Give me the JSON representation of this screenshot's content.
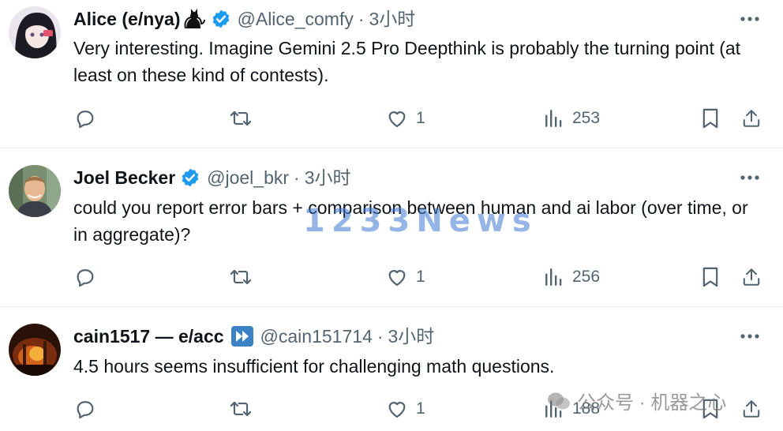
{
  "tweets": [
    {
      "name": "Alice (e/nya)",
      "handle": "@Alice_comfy",
      "time": "3小时",
      "text": "Very interesting. Imagine Gemini 2.5 Pro Deepthink is probably the turning point (at least on these kind of contests).",
      "likes": "1",
      "views": "253",
      "verified": true,
      "emoji_icon": "black-cat-icon"
    },
    {
      "name": "Joel Becker",
      "handle": "@joel_bkr",
      "time": "3小时",
      "text": "could you report error bars + comparison between human and ai labor (over time, or in aggregate)?",
      "likes": "1",
      "views": "256",
      "verified": true
    },
    {
      "name": "cain1517 — e/acc",
      "handle": "@cain151714",
      "time": "3小时",
      "text": "4.5 hours seems insufficient for challenging math questions.",
      "likes": "1",
      "views": "188",
      "verified": false,
      "emoji_icon": "fast-forward-icon"
    }
  ],
  "separator": "·",
  "watermark_text": "1233News",
  "footer_watermark": "公众号 · 机器之心",
  "colors": {
    "text": "#0f1419",
    "secondary": "#536471",
    "verified": "#1d9bf0",
    "divider": "#eff3f4"
  }
}
